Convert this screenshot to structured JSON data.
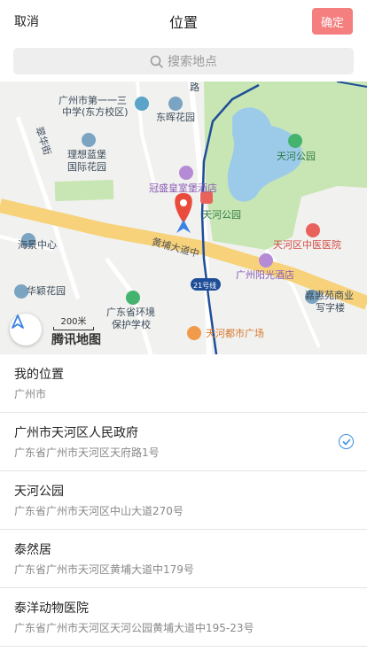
{
  "header": {
    "cancel_label": "取消",
    "title": "位置",
    "confirm_label": "确定"
  },
  "search": {
    "placeholder": "搜索地点",
    "icon": "search-icon"
  },
  "map": {
    "labels": {
      "guangzhou_no1_line1": "广州市第一一三",
      "guangzhou_no1_line2": "中学(东方校区)",
      "donghui_garden": "东晖花园",
      "road_top": "路",
      "lixiang_line1": "理想蓝堡",
      "lixiang_line2": "国际花园",
      "tianhe_park_top": "天河公园",
      "guansheng_hotel": "冠盛皇室堡酒店",
      "tianhe_park_marker": "天河公园",
      "haijing_center": "海景中心",
      "huangpu_road": "黄埔大道中",
      "tianhe_chinese_hospital": "天河区中医医院",
      "yangguang_hotel": "广州阳光酒店",
      "huaying_garden": "华颖花园",
      "line_21": "21号线",
      "env_school_line1": "广东省环境",
      "env_school_line2": "保护学校",
      "jiahuiyuan_line1": "嘉惠苑商业",
      "jiahuiyuan_line2": "写字楼",
      "tianhe_city_plaza": "天河都市广场",
      "cui_hua_street": "翠华街"
    },
    "scale_label": "200米",
    "brand": "腾讯地图",
    "colors": {
      "park": "#c8e6b4",
      "water": "#9ccbea",
      "main_road": "#f7d27a",
      "metro_line": "#1f4e98",
      "pin": "#e94b3c",
      "arrow": "#3b82e6"
    }
  },
  "places": [
    {
      "name": "我的位置",
      "address": "广州市",
      "selected": false
    },
    {
      "name": "广州市天河区人民政府",
      "address": "广东省广州市天河区天府路1号",
      "selected": true
    },
    {
      "name": "天河公园",
      "address": "广东省广州市天河区中山大道270号",
      "selected": false
    },
    {
      "name": "泰然居",
      "address": "广东省广州市天河区黄埔大道中179号",
      "selected": false
    },
    {
      "name": "泰洋动物医院",
      "address": "广东省广州市天河区天河公园黄埔大道中195-23号",
      "selected": false
    }
  ]
}
